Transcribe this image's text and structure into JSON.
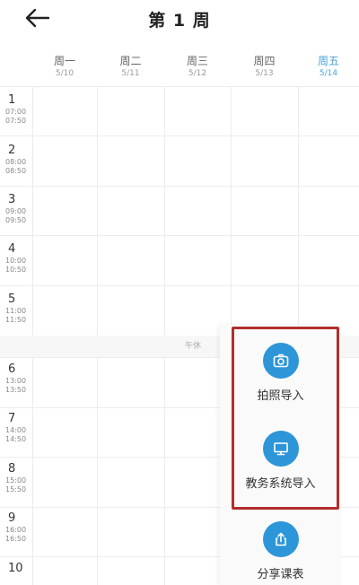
{
  "header": {
    "title": "第 1 周",
    "back_icon": "arrow-left-icon"
  },
  "days": [
    {
      "name": "周一",
      "date": "5/10",
      "active": false
    },
    {
      "name": "周二",
      "date": "5/11",
      "active": false
    },
    {
      "name": "周三",
      "date": "5/12",
      "active": false
    },
    {
      "name": "周四",
      "date": "5/13",
      "active": false
    },
    {
      "name": "周五",
      "date": "5/14",
      "active": true
    }
  ],
  "slots": [
    {
      "num": "1",
      "start": "07:00",
      "end": "07:50"
    },
    {
      "num": "2",
      "start": "08:00",
      "end": "08:50"
    },
    {
      "num": "3",
      "start": "09:00",
      "end": "09:50"
    },
    {
      "num": "4",
      "start": "10:00",
      "end": "10:50"
    },
    {
      "num": "5",
      "start": "11:00",
      "end": "11:50"
    },
    {
      "num": "6",
      "start": "13:00",
      "end": "13:50"
    },
    {
      "num": "7",
      "start": "14:00",
      "end": "14:50"
    },
    {
      "num": "8",
      "start": "15:00",
      "end": "15:50"
    },
    {
      "num": "9",
      "start": "16:00",
      "end": "16:50"
    },
    {
      "num": "10",
      "start": "",
      "end": ""
    }
  ],
  "noon_label": "午休",
  "actions": [
    {
      "label": "拍照导入",
      "icon": "camera-icon"
    },
    {
      "label": "教务系统导入",
      "icon": "monitor-icon"
    },
    {
      "label": "分享课表",
      "icon": "share-icon"
    }
  ],
  "colors": {
    "accent": "#2d96d8",
    "active_day": "#4aa3d6",
    "highlight_border": "#b22d2d"
  }
}
